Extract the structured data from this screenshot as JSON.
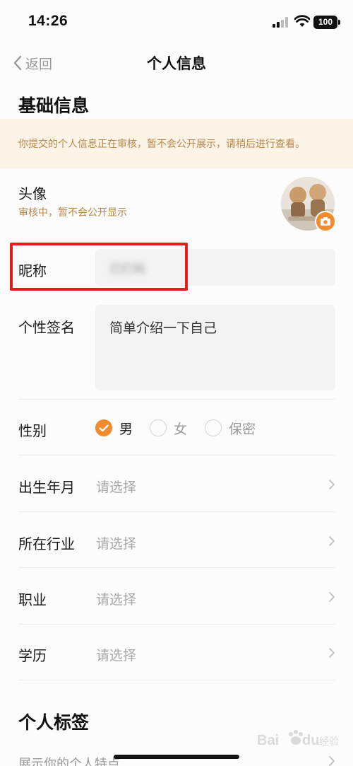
{
  "status_bar": {
    "time": "14:26",
    "battery": "100"
  },
  "nav": {
    "back_label": "返回",
    "title": "个人信息"
  },
  "basic_info": {
    "section_title": "基础信息",
    "notice": "你提交的个人信息正在审核，暂不会公开展示，请稍后进行查看。",
    "avatar": {
      "label": "头像",
      "note": "审核中，暂不会公开显示"
    },
    "nickname": {
      "label": "昵称",
      "value": "已打码"
    },
    "bio": {
      "label": "个性签名",
      "placeholder": "简单介绍一下自己"
    },
    "gender": {
      "label": "性别",
      "options": [
        {
          "label": "男",
          "checked": true
        },
        {
          "label": "女",
          "checked": false
        },
        {
          "label": "保密",
          "checked": false
        }
      ]
    },
    "selects": [
      {
        "label": "出生年月",
        "value": "请选择"
      },
      {
        "label": "所在行业",
        "value": "请选择"
      },
      {
        "label": "职业",
        "value": "请选择"
      },
      {
        "label": "学历",
        "value": "请选择"
      }
    ]
  },
  "personal_tags": {
    "section_title": "个人标签",
    "placeholder": "展示你的个人特点"
  },
  "watermark": "Bai du 经验",
  "colors": {
    "accent": "#f28a2e",
    "notice_bg": "#fdf3e6",
    "notice_text": "#b8874a",
    "highlight": "#e01e1e"
  }
}
